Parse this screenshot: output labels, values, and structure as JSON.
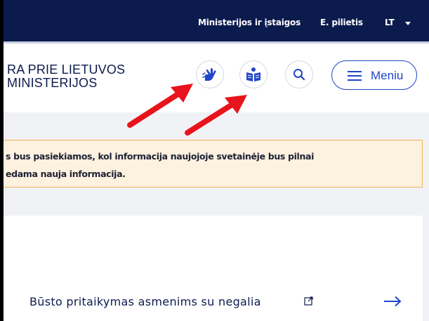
{
  "topbar": {
    "links": [
      "Ministerijos ir įstaigos",
      "E. pilietis"
    ],
    "language": "LT"
  },
  "header": {
    "logo_line1": "RA PRIE LIETUVOS",
    "logo_line2": "MINISTERIJOS",
    "buttons": {
      "sign_language": "sign-language-icon",
      "easy_read": "easy-read-icon",
      "search": "search-icon"
    },
    "menu_label": "Meniu"
  },
  "notice": {
    "line1": "s bus pasiekiamos, kol informacija naujojoje svetainėje bus pilnai",
    "line2": "edama nauja informacija."
  },
  "card": {
    "link_text": "Būsto pritaikymas asmenims su negalia"
  },
  "colors": {
    "topbar_bg": "#0c1b4d",
    "accent_blue": "#1f45c8",
    "notice_bg": "#fdf1df",
    "notice_border": "#f2b05c",
    "annotation_red": "#e8141b"
  }
}
